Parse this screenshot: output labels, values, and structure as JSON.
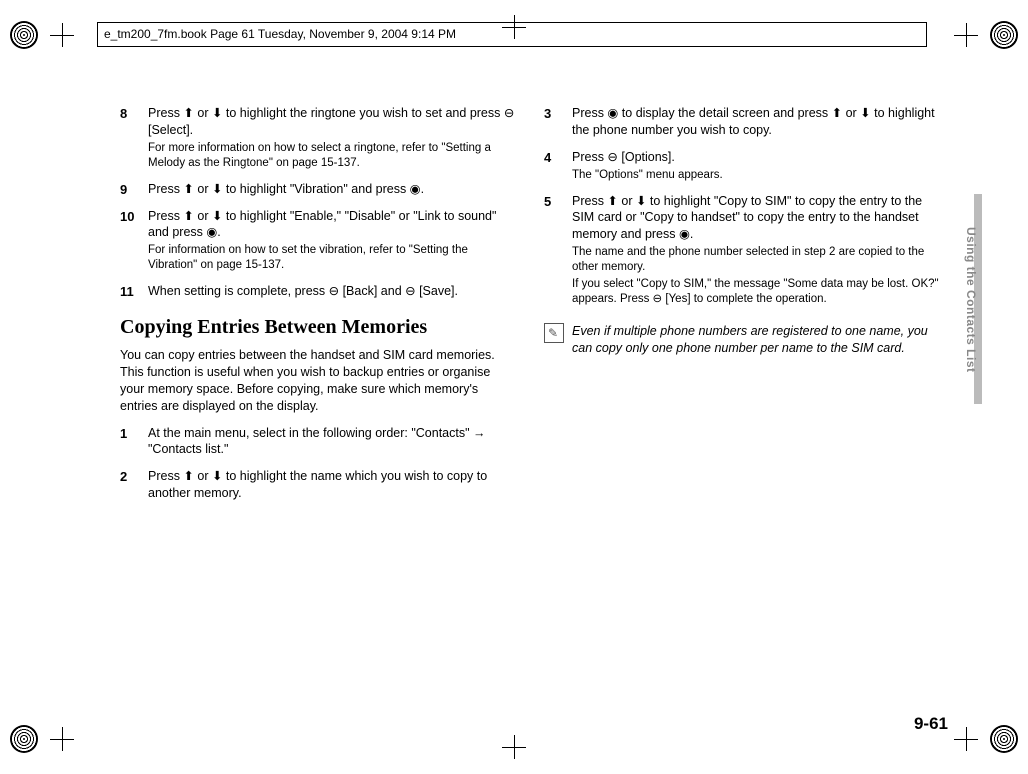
{
  "frame_header": "e_tm200_7fm.book  Page 61  Tuesday, November 9, 2004  9:14 PM",
  "side_tab": "Using the Contacts List",
  "page_number": "9-61",
  "left": {
    "step8": {
      "num": "8",
      "text": "Press ⬆ or ⬇ to highlight the ringtone you wish to set and press ⊖ [Select].",
      "sub": "For more information on how to select a ringtone, refer to \"Setting a Melody as the Ringtone\" on page 15-137."
    },
    "step9": {
      "num": "9",
      "text": "Press ⬆ or ⬇ to highlight \"Vibration\" and press ◉."
    },
    "step10": {
      "num": "10",
      "text": "Press ⬆ or ⬇ to highlight \"Enable,\" \"Disable\" or \"Link to sound\" and press ◉.",
      "sub": "For information on how to set the vibration, refer to \"Setting the Vibration\" on page 15-137."
    },
    "step11": {
      "num": "11",
      "text": "When setting is complete, press ⊖ [Back] and ⊖ [Save]."
    },
    "section_title": "Copying Entries Between Memories",
    "intro": "You can copy entries between the handset and SIM card memories. This function is useful when you wish to backup entries or organise your memory space. Before copying, make sure which memory's entries are displayed on the display.",
    "step1": {
      "num": "1",
      "text": "At the main menu, select in the following order: \"Contacts\" → \"Contacts list.\""
    },
    "step2": {
      "num": "2",
      "text": "Press ⬆ or ⬇ to highlight the name which you wish to copy to another memory."
    }
  },
  "right": {
    "step3": {
      "num": "3",
      "text": "Press ◉ to display the detail screen and press ⬆ or ⬇ to highlight the phone number you wish to copy."
    },
    "step4": {
      "num": "4",
      "text": "Press ⊖ [Options].",
      "sub": "The \"Options\" menu appears."
    },
    "step5": {
      "num": "5",
      "text": "Press ⬆ or ⬇ to highlight \"Copy to SIM\" to copy the entry to the SIM card or \"Copy to handset\" to copy the entry to the handset memory and press ◉.",
      "sub1": "The name and the phone number selected in step 2 are copied to the other memory.",
      "sub2": "If you select \"Copy to SIM,\" the message \"Some data may be lost. OK?\" appears. Press ⊖ [Yes] to complete the operation."
    },
    "note": "Even if multiple phone numbers are registered to one name, you can copy only one phone number per name to the SIM card."
  }
}
